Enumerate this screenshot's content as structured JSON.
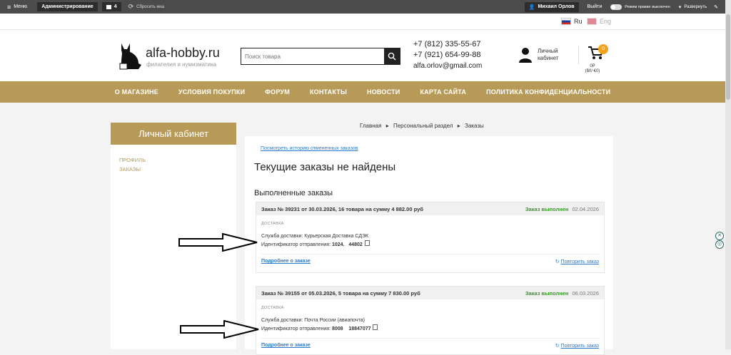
{
  "admin_bar": {
    "menu": "Меню",
    "administration": "Администрирование",
    "count": "4",
    "clear_cache": "Сбросить кеш",
    "user": "Михаил Орлов",
    "logout": "Выйти",
    "edit_mode_label": "Режим правки",
    "edit_mode_state": "выключен",
    "expand": "Развернуть"
  },
  "lang": {
    "ru": "Ru",
    "eng": "Eng"
  },
  "header": {
    "logo_name": "alfa-hobby.ru",
    "logo_sub": "филателия и нумизматика",
    "search_placeholder": "Поиск товара",
    "phone1": "+7 (812) 335-55-67",
    "phone2": "+7 (921) 654-99-88",
    "email": "alfa.orlov@gmail.com",
    "account_line1": "Личный",
    "account_line2": "кабинет",
    "cart_badge": "0",
    "cart_sum1": "0Р",
    "cart_sum2": "($0/ €0)"
  },
  "nav": [
    "О МАГАЗИНЕ",
    "УСЛОВИЯ ПОКУПКИ",
    "ФОРУМ",
    "КОНТАКТЫ",
    "НОВОСТИ",
    "КАРТА САЙТА",
    "ПОЛИТИКА КОНФИДЕНЦИАЛЬНОСТИ"
  ],
  "sidebar": {
    "title": "Личный кабинет",
    "links": [
      "ПРОФИЛЬ",
      "ЗАКАЗЫ"
    ]
  },
  "breadcrumb": [
    "Главная",
    "Персональный раздел",
    "Заказы"
  ],
  "main": {
    "cancelled_link": "Посмотреть историю отмененных заказов",
    "current_heading": "Текущие заказы не найдены",
    "done_heading": "Выполненные заказы"
  },
  "orders": [
    {
      "title": "Заказ № 39231 от 30.03.2026, 16 товара на сумму 4 882.00 руб",
      "status": "Заказ выполнен",
      "date": "02.04.2026",
      "section": "ДОСТАВКА",
      "service": "Служба доставки: Курьерская Доставка СДЭК",
      "tracking_label": "Идентификатор отправления:",
      "tracking_value": "1024.   44802",
      "details": "Подробнее о заказе",
      "repeat": "Повторить заказ"
    },
    {
      "title": "Заказ № 39155 от 05.03.2026, 5 товара на сумму 7 830.00 руб",
      "status": "Заказ выполнен",
      "date": "06.03.2026",
      "section": "ДОСТАВКА",
      "service": "Служба доставки: Почта России (авиапочта)",
      "tracking_label": "Идентификатор отправления:",
      "tracking_value": "8008    18847077",
      "details": "Подробнее о заказе",
      "repeat": "Повторить заказ"
    }
  ],
  "colors": {
    "accent": "#b89a58",
    "admin_bg": "#4b4b4b",
    "status": "#3c9a2c",
    "link": "#2a7ac8"
  }
}
